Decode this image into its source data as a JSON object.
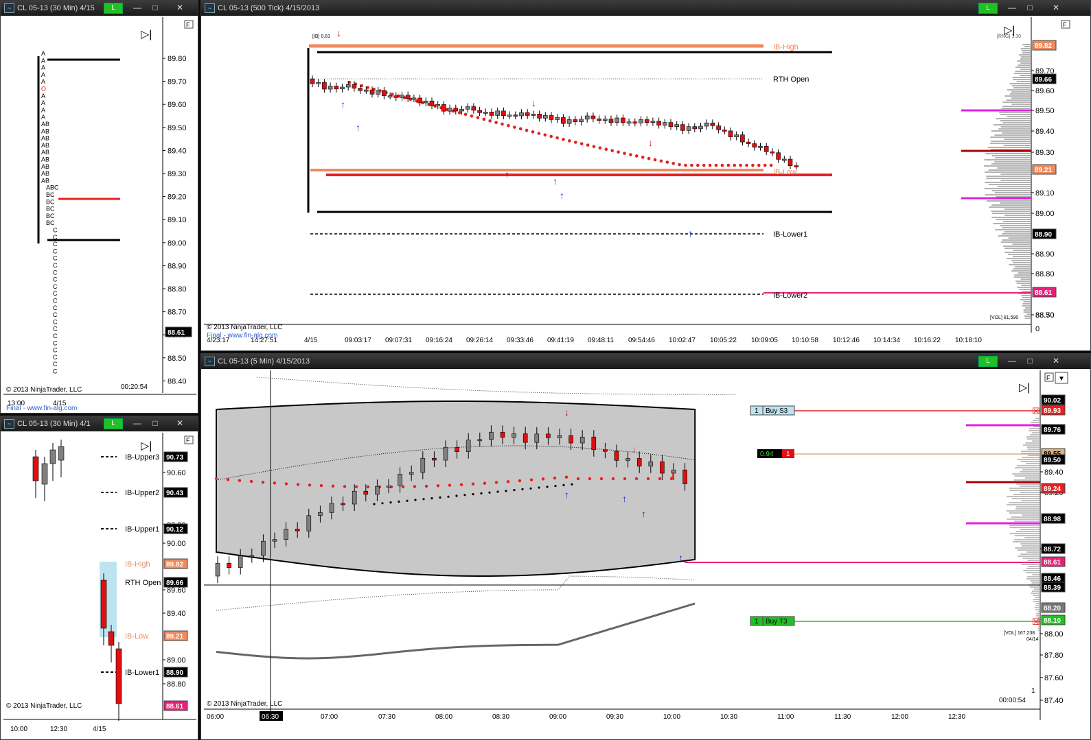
{
  "windows": {
    "profile30": {
      "title": "CL 05-13 (30 Min)  4/15",
      "link_label": "L",
      "price_axis": [
        "89.80",
        "89.70",
        "89.60",
        "89.50",
        "89.40",
        "89.30",
        "89.20",
        "89.10",
        "89.00",
        "88.90",
        "88.80",
        "88.70",
        "88.60",
        "88.50",
        "88.40"
      ],
      "last_price": "88.61",
      "tpo_letters": [
        "A",
        "A",
        "A",
        "A",
        "A",
        "O",
        "A",
        "A",
        "A",
        "A",
        "AB",
        "AB",
        "AB",
        "AB",
        "AB",
        "AB",
        "AB",
        "AB",
        "AB",
        "ABC",
        "BC",
        "BC",
        "BC",
        "BC",
        "BC",
        "C",
        "C",
        "C",
        "C",
        "C",
        "C",
        "C",
        "C",
        "C",
        "C",
        "C",
        "C",
        "C",
        "C",
        "C",
        "C",
        "C",
        "C",
        "C",
        "C",
        "C"
      ],
      "copyright": "© 2013 NinjaTrader, LLC",
      "timer": "00:20:54",
      "x_labels": [
        "13:00",
        "4/15"
      ],
      "footer_text": "Final - www.fin-alg.com",
      "panel_f": "F"
    },
    "tick500": {
      "title": "CL 05-13 (500 Tick)  4/15/2013",
      "link_label": "L",
      "price_axis": [
        "89.70",
        "89.60",
        "89.50",
        "89.40",
        "89.30",
        "89.10",
        "89.00",
        "88.90",
        "88.80",
        "88.70",
        "88.50"
      ],
      "price_tags": [
        {
          "label": "89.82",
          "color": "#f08a5a"
        },
        {
          "label": "89.66",
          "color": "#000000"
        },
        {
          "label": "89.21",
          "color": "#f08a5a"
        },
        {
          "label": "88.90",
          "color": "#000000"
        },
        {
          "label": "88.61",
          "color": "#e8207a"
        }
      ],
      "level_labels": [
        {
          "text": "IB-High",
          "color": "#f08a5a"
        },
        {
          "text": "RTH Open",
          "color": "#000000"
        },
        {
          "text": "IB-Low",
          "color": "#f08a5a"
        },
        {
          "text": "IB-Lower1",
          "color": "#000000"
        },
        {
          "text": "IB-Lower2",
          "color": "#000000"
        }
      ],
      "ib_note": "[IB] 0.61",
      "rng_note": "[RNG] 1.30",
      "vol_note": "[VOL] 81,590",
      "axis_zero": "0",
      "copyright": "© 2013 NinjaTrader, LLC",
      "footer_text": "Final - www.fin-alg.com",
      "x_labels": [
        "4/23:17",
        "14:27:51",
        "4/15",
        "09:03:17",
        "09:07:31",
        "09:16:24",
        "09:26:14",
        "09:33:46",
        "09:41:19",
        "09:48:11",
        "09:54:46",
        "10:02:47",
        "10:05:22",
        "10:09:05",
        "10:10:58",
        "10:12:46",
        "10:14:34",
        "10:16:22",
        "10:18:10"
      ],
      "panel_f": "F"
    },
    "ib30": {
      "title": "CL 05-13 (30 Min)  4/1",
      "link_label": "L",
      "price_axis": [
        "90.60",
        "90.20",
        "90.00",
        "89.60",
        "89.40",
        "89.00",
        "88.80"
      ],
      "level_labels": [
        {
          "text": "IB-Upper3",
          "color": "#000000",
          "tag": "90.73",
          "tag_color": "#000000"
        },
        {
          "text": "IB-Upper2",
          "color": "#000000",
          "tag": "90.43",
          "tag_color": "#000000"
        },
        {
          "text": "IB-Upper1",
          "color": "#000000",
          "tag": "90.12",
          "tag_color": "#000000"
        },
        {
          "text": "IB-High",
          "color": "#f08a5a",
          "tag": "89.82",
          "tag_color": "#f08a5a"
        },
        {
          "text": "RTH Open",
          "color": "#000000",
          "tag": "89.66",
          "tag_color": "#000000"
        },
        {
          "text": "IB-Low",
          "color": "#f08a5a",
          "tag": "89.21",
          "tag_color": "#f08a5a"
        },
        {
          "text": "IB-Lower1",
          "color": "#000000",
          "tag": "88.90",
          "tag_color": "#000000"
        }
      ],
      "last_tag": "88.61",
      "copyright": "© 2013 NinjaTrader, LLC",
      "x_labels": [
        "10:00",
        "12:30",
        "4/15"
      ],
      "panel_f": "F"
    },
    "min5": {
      "title": "CL 05-13 (5 Min)  4/15/2013",
      "link_label": "L",
      "price_axis": [
        "89.40",
        "89.20",
        "88.80",
        "88.00",
        "87.80",
        "87.60",
        "87.40"
      ],
      "price_tags": [
        {
          "label": "90.02",
          "color": "#000000"
        },
        {
          "label": "89.93",
          "color": "#e52020"
        },
        {
          "label": "89.76",
          "color": "#000000"
        },
        {
          "label": "89.55",
          "color": "#d8b080"
        },
        {
          "label": "89.50",
          "color": "#000000"
        },
        {
          "label": "89.24",
          "color": "#e52020"
        },
        {
          "label": "88.98",
          "color": "#000000"
        },
        {
          "label": "88.72",
          "color": "#000000"
        },
        {
          "label": "88.61",
          "color": "#e8207a"
        },
        {
          "label": "88.46",
          "color": "#000000"
        },
        {
          "label": "88.39",
          "color": "#000000"
        },
        {
          "label": "88.20",
          "color": "#777777"
        },
        {
          "label": "88.10",
          "color": "#22c022"
        }
      ],
      "orders": {
        "buy_s3_qty": "1",
        "buy_s3_label": "Buy S3",
        "pos_value": "0.94",
        "pos_qty": "1",
        "buy_t3_qty": "1",
        "buy_t3_label": "Buy T3"
      },
      "vol_note": "[VOL] 167,238",
      "date_note": "04/14",
      "timer": "00:00:54",
      "page_no": "1",
      "copyright": "© 2013 NinjaTrader, LLC",
      "x_labels": [
        "06:00",
        "06:30",
        "07:00",
        "07:30",
        "08:00",
        "08:30",
        "09:00",
        "09:30",
        "10:00",
        "10:30",
        "11:00",
        "11:30",
        "12:00",
        "12:30"
      ],
      "panel_f": "F"
    }
  },
  "colors": {
    "ib_high": "#f08a5a",
    "ib_low_line": "#e52020",
    "vwap_dots": "#e52020",
    "up_candle": "#808080",
    "down_candle": "#e01010",
    "arrow_up": "#1030e0",
    "arrow_down": "#e01010",
    "volume_profile_hi": "#e020e0",
    "band_fill": "#c8c8c8",
    "last_line": "#e8207a"
  }
}
